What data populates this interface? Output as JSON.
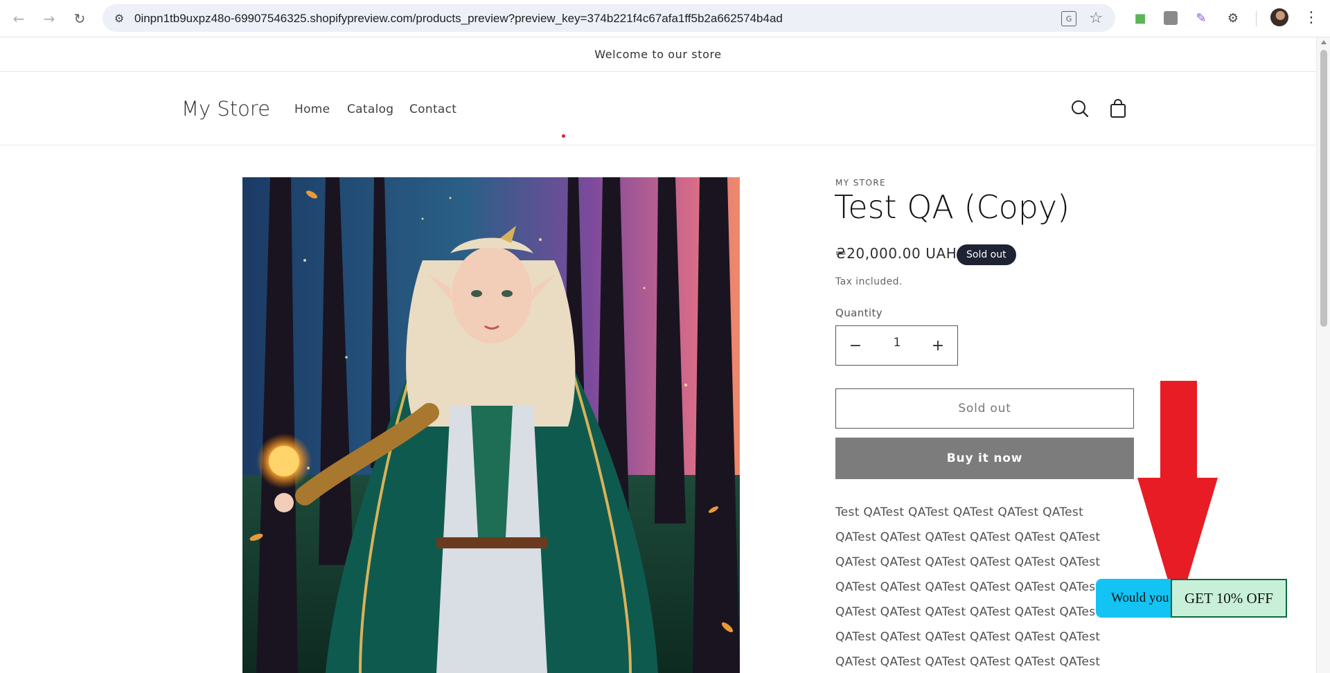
{
  "browser": {
    "url": "0inpn1tb9uxpz48o-69907546325.shopifypreview.com/products_preview?preview_key=374b221f4c67afa1ff5b2a662574b4ad",
    "translate_label": "G"
  },
  "announcement": "Welcome to our store",
  "header": {
    "logo": "My Store",
    "nav": [
      "Home",
      "Catalog",
      "Contact"
    ]
  },
  "product": {
    "vendor": "MY STORE",
    "title": "Test QA (Copy)",
    "price": "₴20,000.00 UAH",
    "badge": "Sold out",
    "tax_note": "Tax included.",
    "quantity_label": "Quantity",
    "quantity_value": "1",
    "sold_out_button": "Sold out",
    "buy_now_button": "Buy it now",
    "description_lines": [
      "Test QATest QATest QATest QATest QATest",
      "QATest QATest QATest QATest QATest QATest",
      "QATest QATest QATest QATest QATest QATest",
      "QATest QATest QATest QATest QATest QATest",
      "QATest QATest QATest QATest QATest QATest",
      "QATest QATest QATest QATest QATest QATest",
      "QATest QATest QATest QATest QATest QATest"
    ]
  },
  "promo": {
    "text": "Would you",
    "cta": "GET 10% OFF"
  },
  "colors": {
    "badge_bg": "#1f2233",
    "buy_button_bg": "#7c7c7c",
    "promo_bar": "#13c3f3",
    "promo_cta": "#c8f0d9",
    "arrow": "#e81c24"
  }
}
